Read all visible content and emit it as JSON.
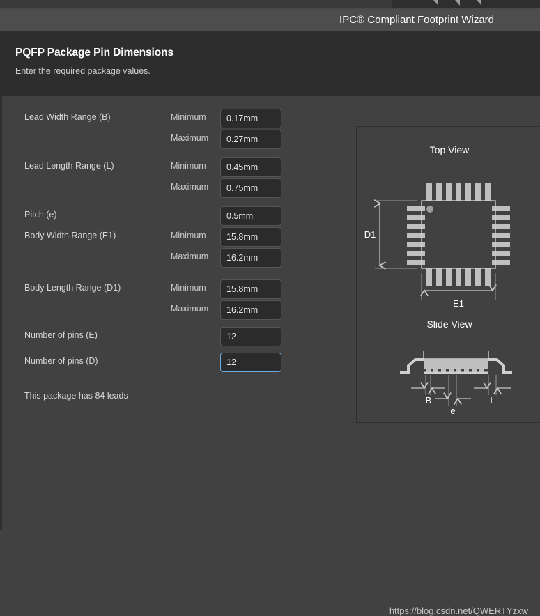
{
  "window": {
    "title": "IPC® Compliant Footprint Wizard"
  },
  "header": {
    "title": "PQFP Package Pin Dimensions",
    "subtitle": "Enter the required package values."
  },
  "colors": {
    "background": "#414141",
    "header_band": "#2d2d2d",
    "titlebar": "#4d4d4d",
    "input_background": "#2b2b2b",
    "input_border": "#555555",
    "focus_border": "#6aaade",
    "text": "#d6d6d6",
    "diagram_stroke": "#c8c8c8"
  },
  "form": {
    "minimum_label": "Minimum",
    "maximum_label": "Maximum",
    "rows": [
      {
        "label": "Lead Width Range (B)",
        "qualifier": "Minimum",
        "value": "0.17mm",
        "focused": false
      },
      {
        "label": "",
        "qualifier": "Maximum",
        "value": "0.27mm",
        "focused": false
      },
      {
        "label": "Lead Length Range (L)",
        "qualifier": "Minimum",
        "value": "0.45mm",
        "focused": false
      },
      {
        "label": "",
        "qualifier": "Maximum",
        "value": "0.75mm",
        "focused": false
      },
      {
        "label": "Pitch (e)",
        "qualifier": "",
        "value": "0.5mm",
        "focused": false
      },
      {
        "label": "Body Width Range (E1)",
        "qualifier": "Minimum",
        "value": "15.8mm",
        "focused": false
      },
      {
        "label": "",
        "qualifier": "Maximum",
        "value": "16.2mm",
        "focused": false
      },
      {
        "label": "Body Length Range (D1)",
        "qualifier": "Minimum",
        "value": "15.8mm",
        "focused": false
      },
      {
        "label": "",
        "qualifier": "Maximum",
        "value": "16.2mm",
        "focused": false
      },
      {
        "label": "Number of pins (E)",
        "qualifier": "",
        "value": "12",
        "focused": false
      },
      {
        "label": "Number of pins (D)",
        "qualifier": "",
        "value": "12",
        "focused": true
      }
    ],
    "lead_note": "This package has 84 leads"
  },
  "diagram": {
    "top_view_title": "Top View",
    "slide_view_title": "Slide View",
    "dimension_d1": "D1",
    "dimension_e1": "E1",
    "dimension_b": "B",
    "dimension_e": "e",
    "dimension_l": "L",
    "pin_marker": "pin-1-dot"
  },
  "watermark": {
    "text": "https://blog.csdn.net/QWERTYzxw"
  }
}
